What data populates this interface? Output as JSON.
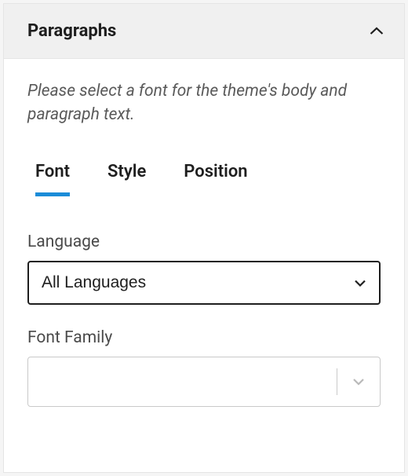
{
  "header": {
    "title": "Paragraphs"
  },
  "description": "Please select a font for the theme's body and paragraph text.",
  "tabs": [
    {
      "label": "Font",
      "active": true
    },
    {
      "label": "Style",
      "active": false
    },
    {
      "label": "Position",
      "active": false
    }
  ],
  "fields": {
    "language": {
      "label": "Language",
      "value": "All Languages"
    },
    "font_family": {
      "label": "Font Family",
      "value": ""
    }
  }
}
